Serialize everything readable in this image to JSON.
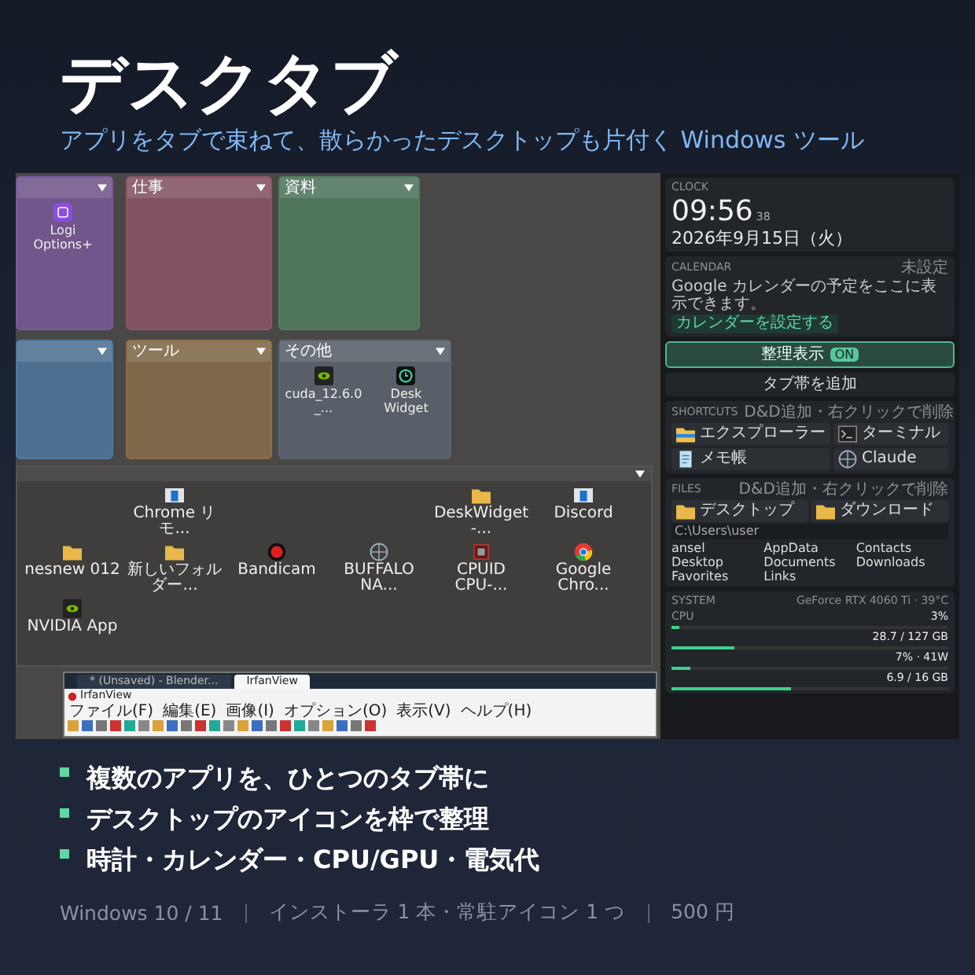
{
  "hero": {
    "title": "デスクタブ",
    "subtitle": "アプリをタブで束ねて、散らかったデスクトップも片付く Windows ツール"
  },
  "screenshot": {
    "fences": [
      {
        "color": "#7a5a9c",
        "icons": [
          {
            "label": "Logi Options+",
            "kind": "logi"
          }
        ]
      },
      {
        "label": "仕事",
        "color": "#8f5567"
      },
      {
        "label": "資料",
        "color": "#4f7f5f"
      },
      {
        "color": "#4f7ba2"
      },
      {
        "label": "ツール",
        "color": "#8b6f49"
      },
      {
        "label": "その他",
        "color": "#5b6571",
        "icons": [
          {
            "label": "cuda_12.6.0_...",
            "kind": "nvidia"
          },
          {
            "label": "Desk Widget",
            "kind": "clock"
          }
        ]
      }
    ],
    "open_fence": {
      "icons": [
        {
          "label": "Chrome リモ...",
          "kind": "window"
        },
        {
          "label": "DeskWidget-...",
          "kind": "folder"
        },
        {
          "label": "Discord",
          "kind": "window"
        },
        {
          "label": "nesnew 012",
          "kind": "folder"
        },
        {
          "label": "新しいフォルダー...",
          "kind": "folder"
        },
        {
          "label": "Bandicam",
          "kind": "record"
        },
        {
          "label": "BUFFALO NA...",
          "kind": "globe"
        },
        {
          "label": "CPUID CPU-...",
          "kind": "chip"
        },
        {
          "label": "Google Chro...",
          "kind": "chrome"
        },
        {
          "label": "NVIDIA App",
          "kind": "nvidia"
        }
      ]
    },
    "window": {
      "tabs": [
        {
          "label": "* (Unsaved) - Blender...",
          "selected": false
        },
        {
          "label": "IrfanView",
          "selected": true
        }
      ],
      "title": "IrfanView",
      "menu": [
        "ファイル(F)",
        "編集(E)",
        "画像(I)",
        "オプション(O)",
        "表示(V)",
        "ヘルプ(H)"
      ]
    },
    "sidebar": {
      "clock": {
        "heading": "CLOCK",
        "time": "09:56",
        "seconds": "38",
        "date": "2026年9月15日（火）"
      },
      "calendar": {
        "heading": "CALENDAR",
        "status": "未設定",
        "message": "Google カレンダーの予定をここに表示できます。",
        "button": "カレンダーを設定する"
      },
      "organize": {
        "label": "整理表示",
        "badge": "ON",
        "on": true
      },
      "add_tab": "タブ帯を追加",
      "shortcuts": {
        "heading": "SHORTCUTS",
        "hint": "D&D追加・右クリックで削除",
        "items": [
          {
            "label": "エクスプローラー",
            "kind": "explorer"
          },
          {
            "label": "ターミナル",
            "kind": "terminal"
          },
          {
            "label": "メモ帳",
            "kind": "notepad"
          },
          {
            "label": "Claude",
            "kind": "globe"
          }
        ]
      },
      "files": {
        "heading": "FILES",
        "hint": "D&D追加・右クリックで削除",
        "folders": [
          "デスクトップ",
          "ダウンロード"
        ],
        "path": "C:\\Users\\user",
        "entries": [
          "ansel",
          "AppData",
          "Contacts",
          "Desktop",
          "Documents",
          "Downloads",
          "Favorites",
          "Links"
        ]
      },
      "system": {
        "heading": "SYSTEM",
        "gpu": "GeForce RTX 4060 Ti · 39°C",
        "rows": [
          {
            "label": "CPU",
            "value": "3%",
            "level": 0.03
          },
          {
            "value": "28.7 / 127 GB",
            "level": 0.23
          },
          {
            "value": "7% · 41W",
            "level": 0.07
          },
          {
            "value": "6.9 / 16 GB",
            "level": 0.43
          }
        ]
      }
    }
  },
  "features": [
    "複数のアプリを、ひとつのタブ帯に",
    "デスクトップのアイコンを枠で整理",
    "時計・カレンダー・CPU/GPU・電気代"
  ],
  "footer": [
    "Windows 10 / 11",
    "インストーラ 1 本・常駐アイコン 1 つ",
    "500 円"
  ]
}
